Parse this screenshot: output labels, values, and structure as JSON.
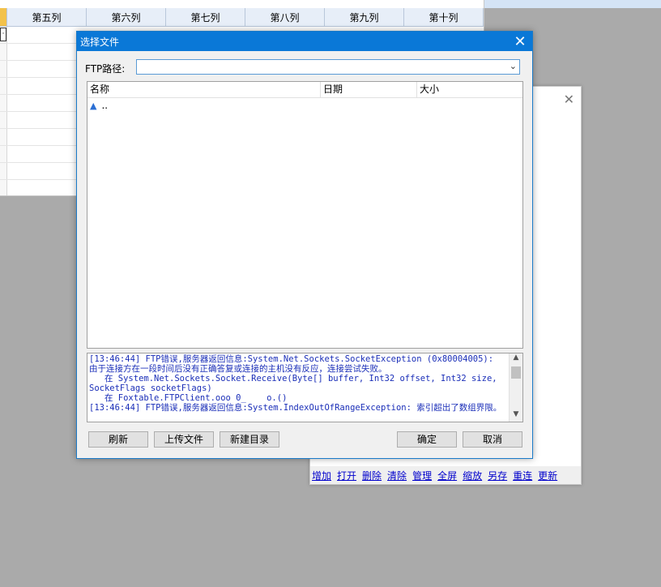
{
  "grid": {
    "columns": [
      "第五列",
      "第六列",
      "第七列",
      "第八列",
      "第九列",
      "第十列"
    ],
    "cursor_glyph": "·"
  },
  "background_panel": {
    "close_glyph": "✕",
    "links": [
      "增加",
      "打开",
      "删除",
      "清除",
      "管理",
      "全屏",
      "缩放",
      "另存",
      "重连",
      "更新"
    ]
  },
  "dialog": {
    "title": "选择文件",
    "close_glyph": "✕",
    "ftp_label": "FTP路径:",
    "ftp_value": "",
    "columns": [
      "名称",
      "日期",
      "大小"
    ],
    "rows": [
      {
        "icon": "up-arrow-icon",
        "name": ".."
      }
    ],
    "log": "[13:46:44] FTP错误,服务器返回信息:System.Net.Sockets.SocketException (0x80004005): 由于连接方在一段时间后没有正确答复或连接的主机没有反应，连接尝试失败。\n   在 System.Net.Sockets.Socket.Receive(Byte[] buffer, Int32 offset, Int32 size, SocketFlags socketFlags)\n   在 Foxtable.FTPClient.ooo 0_    o.()\n[13:46:44] FTP错误,服务器返回信息:System.IndexOutOfRangeException: 索引超出了数组界限。",
    "buttons": {
      "refresh": "刷新",
      "upload": "上传文件",
      "new_dir": "新建目录",
      "ok": "确定",
      "cancel": "取消"
    }
  }
}
